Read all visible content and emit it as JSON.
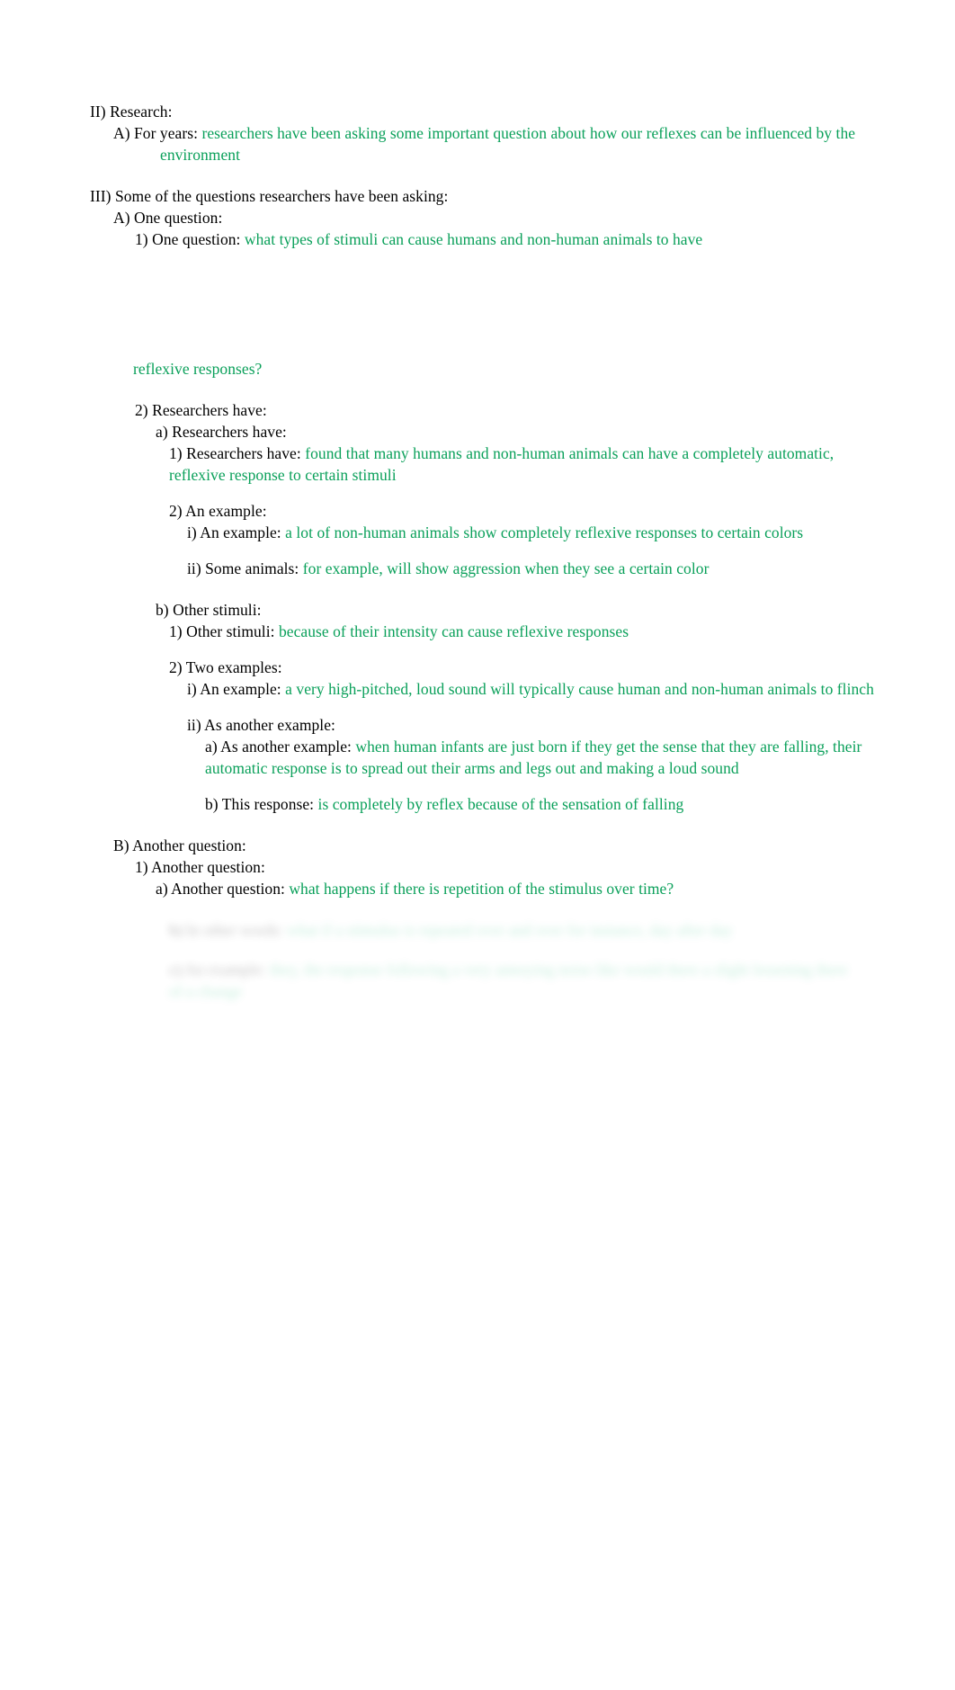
{
  "document": {
    "colors": {
      "body_text": "#000000",
      "highlight_text": "#0aa05a",
      "background": "#ffffff"
    },
    "sections": [
      {
        "id": "sec-ii",
        "marker": "II)",
        "label": "Research:",
        "children": [
          {
            "id": "sec-ii-a",
            "marker": "A)",
            "label": "For years:",
            "green": "researchers have been asking some important question about how our reflexes can be influenced by the environment"
          }
        ]
      },
      {
        "id": "sec-iii",
        "marker": "III)",
        "label": "Some of the questions researchers have been asking:",
        "children": [
          {
            "id": "sec-iii-a",
            "marker": "A)",
            "label": "One question:",
            "children": [
              {
                "id": "sec-iii-a-1",
                "marker": "1)",
                "label": "One question:",
                "green": "what types of stimuli can cause humans and non-human animals to have reflexive responses?"
              },
              {
                "id": "sec-iii-a-2",
                "marker": "2)",
                "label": "Researchers have:",
                "children": [
                  {
                    "id": "sec-iii-a-2-a",
                    "marker": "a)",
                    "label": "Researchers have:",
                    "children": [
                      {
                        "id": "sec-iii-a-2-a-1",
                        "marker": "1)",
                        "label": "Researchers have:",
                        "green": "found that many humans and non-human animals can have a completely automatic, reflexive response to certain stimuli"
                      },
                      {
                        "id": "sec-iii-a-2-a-2",
                        "marker": "2)",
                        "label": "An example:",
                        "children": [
                          {
                            "id": "sec-iii-a-2-a-2-i",
                            "marker": "i)",
                            "label": "An example:",
                            "green": "a lot of non-human animals show completely reflexive responses to certain colors"
                          },
                          {
                            "id": "sec-iii-a-2-a-2-ii",
                            "marker": "ii)",
                            "label": "Some animals:",
                            "green": "for example, will show aggression when they see a certain color"
                          }
                        ]
                      }
                    ]
                  },
                  {
                    "id": "sec-iii-a-2-b",
                    "marker": "b)",
                    "label": "Other stimuli:",
                    "children": [
                      {
                        "id": "sec-iii-a-2-b-1",
                        "marker": "1)",
                        "label": "Other stimuli:",
                        "green": "because of their intensity can cause reflexive responses"
                      },
                      {
                        "id": "sec-iii-a-2-b-2",
                        "marker": "2)",
                        "label": "Two examples:",
                        "children": [
                          {
                            "id": "sec-iii-a-2-b-2-i",
                            "marker": "i)",
                            "label": "An example:",
                            "green": "a very high-pitched, loud sound will typically cause human and non-human animals to flinch"
                          },
                          {
                            "id": "sec-iii-a-2-b-2-ii",
                            "marker": "ii)",
                            "label": "As another example:",
                            "children": [
                              {
                                "id": "sec-iii-a-2-b-2-ii-a",
                                "marker": "a)",
                                "label": "As another example:",
                                "green": "when human infants are just born if they get the sense that they are falling, their automatic response is to spread out their arms and legs out and making a loud sound"
                              },
                              {
                                "id": "sec-iii-a-2-b-2-ii-b",
                                "marker": "b)",
                                "label": "This response:",
                                "green": "is completely by reflex because of the sensation of falling"
                              }
                            ]
                          }
                        ]
                      }
                    ]
                  }
                ]
              }
            ]
          },
          {
            "id": "sec-iii-b",
            "marker": "B)",
            "label": "Another question:",
            "children": [
              {
                "id": "sec-iii-b-1",
                "marker": "1)",
                "label": "Another question:",
                "children": [
                  {
                    "id": "sec-iii-b-1-a",
                    "marker": "a)",
                    "label": "Another question:",
                    "green": "what happens if there is repetition of the stimulus over time?"
                  }
                ]
              }
            ]
          }
        ]
      }
    ]
  },
  "lines": {
    "l01_marker": "II)",
    "l01_label": "Research:",
    "l02_marker": "A)",
    "l02_label": "For years:",
    "l02_green": "researchers have been asking some important question about how our reflexes can be influenced by the environment",
    "l03_marker": "III)",
    "l03_label": "Some of the questions researchers have been asking:",
    "l04_marker": "A)",
    "l04_label": "One question:",
    "l05_marker": "1)",
    "l05_label": "One question:",
    "l05_green_a": "what types of stimuli can cause humans and non-human animals to have",
    "l05_green_b": "reflexive responses?",
    "l06_marker": "2)",
    "l06_label": "Researchers have:",
    "l07_marker": "a)",
    "l07_label": "Researchers have:",
    "l08_marker": "1)",
    "l08_label": "Researchers have:",
    "l08_green": "found that many humans and non-human animals can have a completely automatic, reflexive response to certain stimuli",
    "l09_marker": "2)",
    "l09_label": "An example:",
    "l10_marker": "i)",
    "l10_label": "An example:",
    "l10_green": "a lot of non-human animals show completely reflexive responses to certain colors",
    "l11_marker": "ii)",
    "l11_label": "Some animals:",
    "l11_green": "for example, will show aggression when they see a certain color",
    "l12_marker": "b)",
    "l12_label": "Other stimuli:",
    "l13_marker": "1)",
    "l13_label": "Other stimuli:",
    "l13_green": "because of their intensity can cause reflexive responses",
    "l14_marker": "2)",
    "l14_label": "Two examples:",
    "l15_marker": "i)",
    "l15_label": "An example:",
    "l15_green": "a very high-pitched, loud sound will typically cause human and non-human animals to flinch",
    "l16_marker": "ii)",
    "l16_label": "As another example:",
    "l17_marker": "a)",
    "l17_label": "As another example:",
    "l17_green": "when human infants are just born if they get the sense that they are falling, their automatic response is to spread out their arms and legs out and making a loud sound",
    "l18_marker": "b)",
    "l18_label": "This response:",
    "l18_green": "is completely by reflex because of the sensation of falling",
    "l19_marker": "B)",
    "l19_label": "Another question:",
    "l20_marker": "1)",
    "l20_label": "Another question:",
    "l21_marker": "a)",
    "l21_label": "Another question:",
    "l21_green": "what happens if there is repetition of the stimulus over time?",
    "l22_marker": "b)",
    "l22_label": "In other words:",
    "l22_green": "what if a stimulus is repeated over and over for instance, day after day",
    "l23_marker": "c)",
    "l23_label": "An example:",
    "l23_green": "they, the response following a very annoying noise like would there a slight lessening there of a change"
  }
}
